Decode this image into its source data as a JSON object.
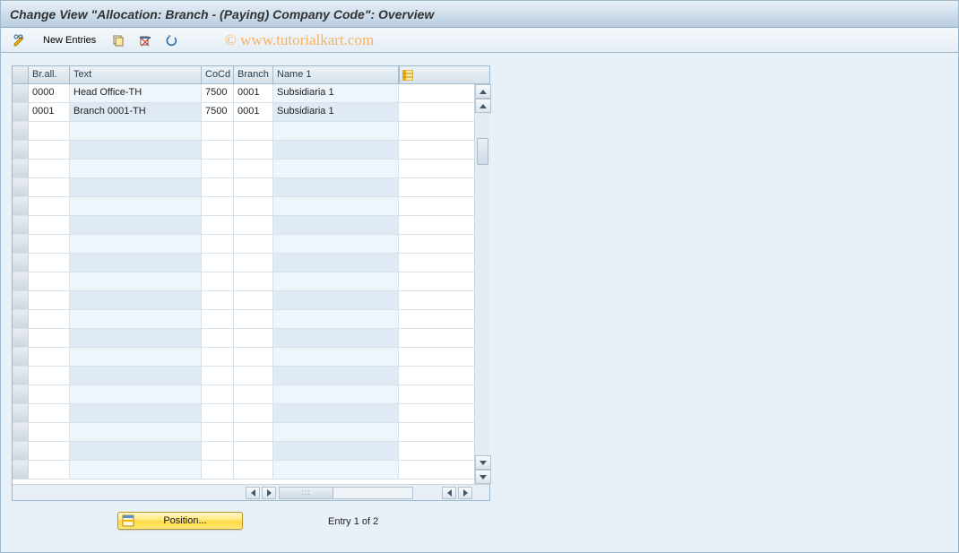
{
  "title": "Change View \"Allocation: Branch - (Paying) Company Code\": Overview",
  "watermark": "© www.tutorialkart.com",
  "toolbar": {
    "new_entries_label": "New Entries"
  },
  "grid": {
    "columns": {
      "brall": "Br.all.",
      "text": "Text",
      "cocd": "CoCd",
      "branch": "Branch",
      "name": "Name 1"
    },
    "rows": [
      {
        "brall": "0000",
        "text": "Head Office-TH",
        "cocd": "7500",
        "branch": "0001",
        "name": "Subsidiaria 1"
      },
      {
        "brall": "0001",
        "text": "Branch 0001-TH",
        "cocd": "7500",
        "branch": "0001",
        "name": "Subsidiaria 1"
      }
    ],
    "empty_rows": 19
  },
  "footer": {
    "position_label": "Position...",
    "entry_text": "Entry 1 of 2"
  }
}
